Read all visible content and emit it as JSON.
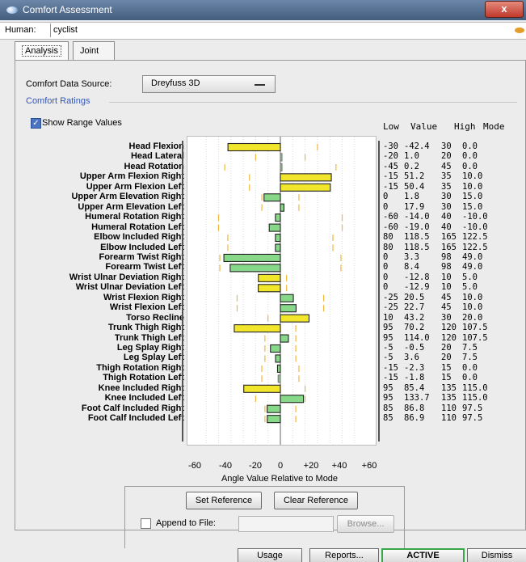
{
  "window": {
    "title": "Comfort Assessment",
    "close_label": "x"
  },
  "human": {
    "label": "Human:",
    "value": "cyclist"
  },
  "tabs": [
    {
      "label": "Analysis"
    },
    {
      "label": "Joint Angles"
    }
  ],
  "data_source": {
    "label": "Comfort Data Source:",
    "value": "Dreyfuss 3D"
  },
  "ratings": {
    "title": "Comfort Ratings",
    "show_range_label": "Show Range Values",
    "show_range_checked": true
  },
  "columns": {
    "low": "Low",
    "value": "Value",
    "high": "High",
    "mode": "Mode"
  },
  "chart_data": {
    "type": "bar",
    "xlabel": "Angle Value Relative to Mode",
    "xlim": [
      -60,
      60
    ],
    "xticks": [
      "-60",
      "-40",
      "-20",
      "0",
      "+20",
      "+40",
      "+60"
    ],
    "categories": [
      "Head Flexion",
      "Head Lateral",
      "Head Rotation",
      "Upper Arm Flexion Right",
      "Upper Arm Flexion Left",
      "Upper Arm Elevation Right",
      "Upper Arm Elevation Left",
      "Humeral Rotation Right",
      "Humeral Rotation Left",
      "Elbow Included Right",
      "Elbow Included Left",
      "Forearm Twist Right",
      "Forearm Twist Left",
      "Wrist Ulnar Deviation Right",
      "Wrist Ulnar Deviation Left",
      "Wrist Flexion Right",
      "Wrist Flexion Left",
      "Torso Recline",
      "Trunk Thigh Right",
      "Trunk Thigh Left",
      "Leg Splay Right",
      "Leg Splay Left",
      "Thigh Rotation Right",
      "Thigh Rotation Left",
      "Knee Included Right",
      "Knee Included Left",
      "Foot Calf Included Right",
      "Foot Calf Included Left"
    ],
    "low": [
      "-30",
      "-20",
      "-45",
      "-15",
      "-15",
      "0",
      "0",
      "-60",
      "-60",
      "80",
      "80",
      "0",
      "0",
      "0",
      "0",
      "-25",
      "-25",
      "10",
      "95",
      "95",
      "-5",
      "-5",
      "-15",
      "-15",
      "95",
      "95",
      "85",
      "85"
    ],
    "value": [
      "-42.4",
      "1.0",
      "0.2",
      "51.2",
      "50.4",
      "1.8",
      "17.9",
      "-14.0",
      "-19.0",
      "118.5",
      "118.5",
      "3.3",
      "8.4",
      "-12.8",
      "-12.9",
      "20.5",
      "22.7",
      "43.2",
      "70.2",
      "114.0",
      "-0.5",
      "3.6",
      "-2.3",
      "-1.8",
      "85.4",
      "133.7",
      "86.8",
      "86.9"
    ],
    "high": [
      "30",
      "20",
      "45",
      "35",
      "35",
      "30",
      "30",
      "40",
      "40",
      "165",
      "165",
      "98",
      "98",
      "10",
      "10",
      "45",
      "45",
      "30",
      "120",
      "120",
      "20",
      "20",
      "15",
      "15",
      "135",
      "135",
      "110",
      "110"
    ],
    "mode": [
      "0.0",
      "0.0",
      "0.0",
      "10.0",
      "10.0",
      "15.0",
      "15.0",
      "-10.0",
      "-10.0",
      "122.5",
      "122.5",
      "49.0",
      "49.0",
      "5.0",
      "5.0",
      "10.0",
      "10.0",
      "20.0",
      "107.5",
      "107.5",
      "7.5",
      "7.5",
      "0.0",
      "0.0",
      "115.0",
      "115.0",
      "97.5",
      "97.5"
    ],
    "relative": [
      -42.4,
      1,
      0.2,
      41.2,
      40.4,
      -13.2,
      2.9,
      -4,
      -9,
      -4,
      -4,
      -45.7,
      -40.6,
      -17.8,
      -17.9,
      10.5,
      12.7,
      23.2,
      -37.3,
      6.5,
      -8,
      -3.9,
      -2.3,
      -1.8,
      -29.6,
      18.7,
      -10.7,
      -10.6
    ],
    "colors": {
      "in_range": "#88d88a",
      "out_of_range": "#f2e62d",
      "range_tick": "#f1b63c"
    }
  },
  "buttons": {
    "set_reference": "Set Reference",
    "clear_reference": "Clear Reference",
    "append_label": "Append to File:",
    "browse": "Browse..."
  },
  "bottom": {
    "usage": "Usage",
    "reports": "Reports...",
    "active": "ACTIVE",
    "dismiss": "Dismiss"
  }
}
